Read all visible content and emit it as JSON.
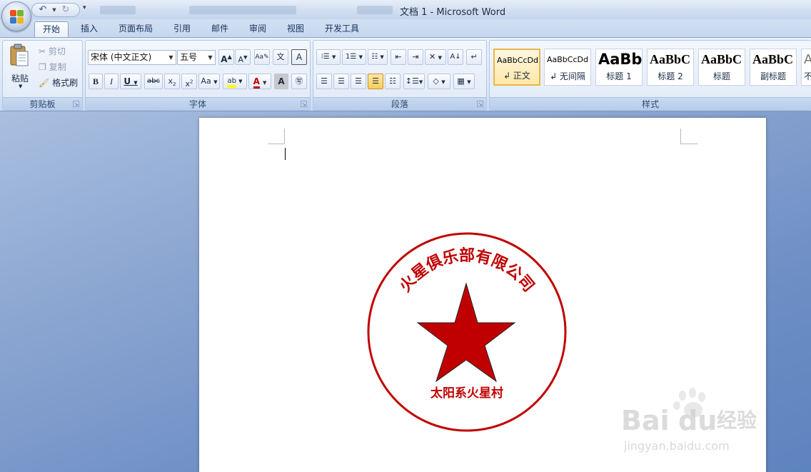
{
  "window": {
    "title": "文档 1 - Microsoft Word"
  },
  "tabs": [
    "开始",
    "插入",
    "页面布局",
    "引用",
    "邮件",
    "审阅",
    "视图",
    "开发工具"
  ],
  "clipboard": {
    "paste": "粘贴",
    "cut": "剪切",
    "copy": "复制",
    "format_painter": "格式刷",
    "label": "剪贴板"
  },
  "font": {
    "name": "宋体 (中文正文)",
    "size": "五号",
    "label": "字体",
    "aa_label": "Aa"
  },
  "paragraph": {
    "label": "段落"
  },
  "styles": {
    "label": "样式",
    "items": [
      {
        "sample": "AaBbCcDd",
        "name": "↲ 正文"
      },
      {
        "sample": "AaBbCcDd",
        "name": "↲ 无间隔"
      },
      {
        "sample": "AaBb",
        "name": "标题 1"
      },
      {
        "sample": "AaBbC",
        "name": "标题 2"
      },
      {
        "sample": "AaBbC",
        "name": "标题"
      },
      {
        "sample": "AaBbC",
        "name": "副标题"
      },
      {
        "sample": "A",
        "name": "不"
      }
    ]
  },
  "seal": {
    "company": "火星俱乐部有限公司",
    "address": "太阳系火星村",
    "color": "#c00000"
  },
  "watermark": {
    "brand": "Bai",
    "brand2": "du",
    "product": "经验",
    "url": "jingyan.baidu.com"
  }
}
